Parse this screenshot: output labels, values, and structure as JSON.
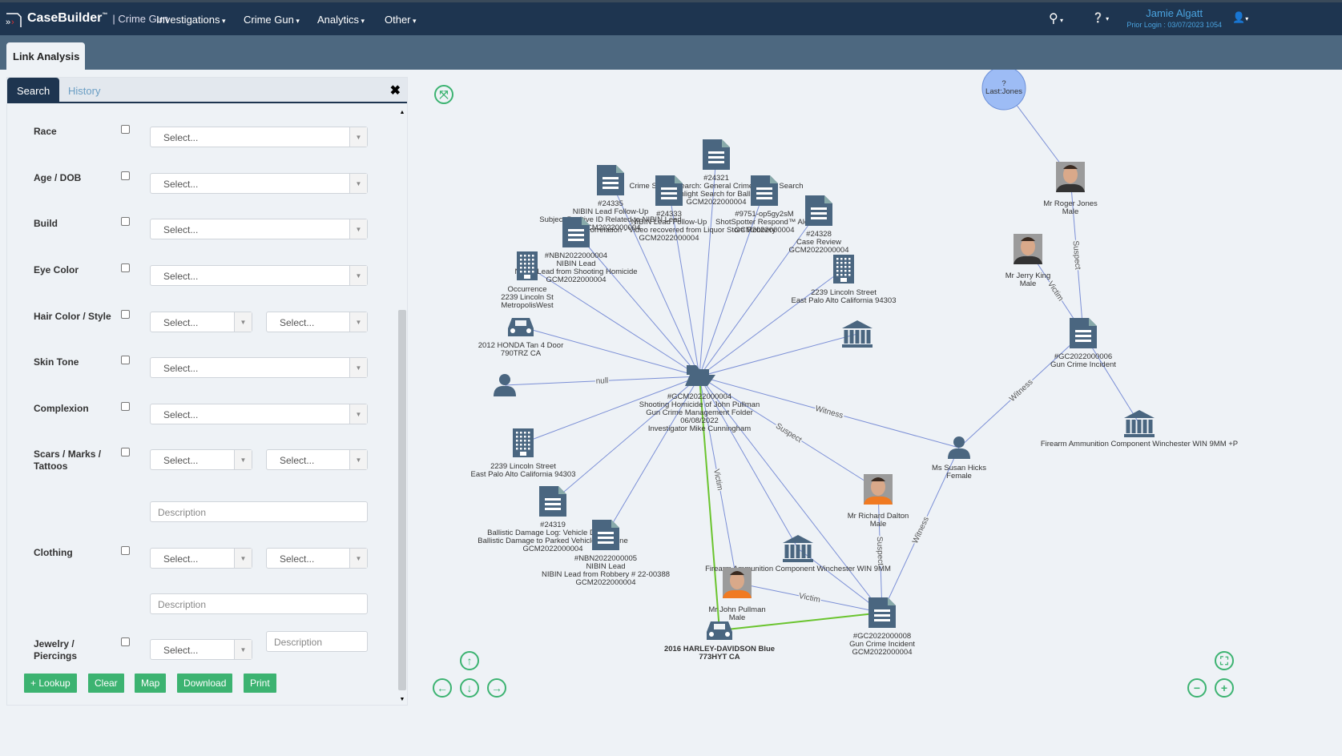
{
  "header": {
    "brand": "CaseBuilder",
    "tm": "™",
    "product": "| Crime Gun",
    "nav": [
      "Investigations",
      "Crime Gun",
      "Analytics",
      "Other"
    ],
    "user_name": "Jamie Algatt",
    "prior_login": "Prior Login : 03/07/2023 1054"
  },
  "main_tab": "Link Analysis",
  "panel": {
    "tabs": [
      "Search",
      "History"
    ],
    "fields": {
      "race": "Race",
      "age": "Age / DOB",
      "build": "Build",
      "eye": "Eye Color",
      "hair": "Hair Color / Style",
      "skin": "Skin Tone",
      "complexion": "Complexion",
      "scars": "Scars / Marks / Tattoos",
      "clothing": "Clothing",
      "jewelry": "Jewelry / Piercings"
    },
    "select_placeholder": "Select...",
    "description_placeholder": "Description",
    "buttons": [
      "+ Lookup",
      "Clear",
      "Map",
      "Download",
      "Print"
    ]
  },
  "graph": {
    "nodes": [
      {
        "id": "center",
        "type": "folder",
        "label": [
          "#GCM2022000004",
          "Shooting Homicide of John Pullman",
          "Gun Crime Management Folder",
          "06/08/2022",
          "Investigator Mike Cunningham"
        ]
      },
      {
        "id": "n24321",
        "type": "doc",
        "label": [
          "#24321",
          "Crime Scene Search: General Crime Scene Search",
          "Flashlight Search for Ballistics",
          "GCM2022000004"
        ]
      },
      {
        "id": "n24335",
        "type": "doc",
        "label": [
          "#24335",
          "NIBIN Lead Follow-Up",
          "Subject Positive ID Related to NIBIN Lead",
          "GCM2022000004"
        ]
      },
      {
        "id": "n24333",
        "type": "doc",
        "label": [
          "#24333",
          "NIBIN Lead Follow-Up",
          "NIBIN Correlation - Video recovered from Liquor Store Robbery",
          "GCM2022000004"
        ]
      },
      {
        "id": "n9751",
        "type": "doc",
        "label": [
          "#9751-op5gy2sM",
          "ShotSpotter Respond™ Alert",
          "GCM2022000004"
        ]
      },
      {
        "id": "n24328",
        "type": "doc",
        "label": [
          "#24328",
          "Case Review",
          "GCM2022000004"
        ]
      },
      {
        "id": "nbn4",
        "type": "doc",
        "label": [
          "#NBN2022000004",
          "NIBIN Lead",
          "NIBIN Lead from Shooting Homicide",
          "GCM2022000004"
        ]
      },
      {
        "id": "occ",
        "type": "building",
        "label": [
          "Occurrence",
          "2239 Lincoln St",
          "MetropolisWest"
        ]
      },
      {
        "id": "addr1",
        "type": "building",
        "label": [
          "2239 Lincoln Street",
          "East Palo Alto California 94303"
        ]
      },
      {
        "id": "car1",
        "type": "car",
        "label": [
          "2012 HONDA Tan 4 Door",
          "790TRZ CA"
        ]
      },
      {
        "id": "bank1",
        "type": "bank",
        "label": []
      },
      {
        "id": "anon",
        "type": "person",
        "label": []
      },
      {
        "id": "addr2",
        "type": "building",
        "label": [
          "2239 Lincoln Street",
          "East Palo Alto California 94303"
        ]
      },
      {
        "id": "n24319",
        "type": "doc",
        "label": [
          "#24319",
          "Ballistic Damage Log: Vehicle Damage",
          "Ballistic Damage to Parked Vehicle at Scene",
          "GCM2022000004"
        ]
      },
      {
        "id": "nbn5",
        "type": "doc",
        "label": [
          "#NBN2022000005",
          "NIBIN Lead",
          "NIBIN Lead from Robbery # 22-00388",
          "GCM2022000004"
        ]
      },
      {
        "id": "bank2",
        "type": "bank",
        "label": [
          "Firearm Ammunition Component Winchester WIN 9MM"
        ]
      },
      {
        "id": "pullman",
        "type": "photo",
        "photo": "orange",
        "label": [
          "Mr John  Pullman",
          "Male"
        ]
      },
      {
        "id": "car2",
        "type": "car",
        "bold": true,
        "label": [
          "2016 HARLEY-DAVIDSON Blue",
          "773HYT CA"
        ]
      },
      {
        "id": "gc8",
        "type": "doc",
        "label": [
          "#GC2022000008",
          "Gun Crime Incident",
          "GCM2022000004"
        ]
      },
      {
        "id": "dalton",
        "type": "photo",
        "photo": "orange",
        "label": [
          "Mr Richard  Dalton",
          "Male"
        ]
      },
      {
        "id": "hicks",
        "type": "person",
        "label": [
          "Ms Susan  Hicks",
          "Female"
        ]
      },
      {
        "id": "gc6",
        "type": "doc",
        "label": [
          "#GC2022000006",
          "Gun Crime Incident"
        ]
      },
      {
        "id": "bank3",
        "type": "bank",
        "label": [
          "Firearm Ammunition Component Winchester WIN 9MM +P"
        ]
      },
      {
        "id": "jones",
        "type": "circle",
        "label": [
          "?",
          "Last:Jones"
        ]
      },
      {
        "id": "rjones",
        "type": "photo",
        "photo": "grey",
        "label": [
          "Mr Roger  Jones",
          "Male"
        ]
      },
      {
        "id": "king",
        "type": "photo",
        "photo": "grey",
        "label": [
          "Mr Jerry  King",
          "Male"
        ]
      }
    ],
    "edges": [
      {
        "from": "center",
        "to": "n24321"
      },
      {
        "from": "center",
        "to": "n24335"
      },
      {
        "from": "center",
        "to": "n24333"
      },
      {
        "from": "center",
        "to": "n9751"
      },
      {
        "from": "center",
        "to": "n24328"
      },
      {
        "from": "center",
        "to": "nbn4"
      },
      {
        "from": "center",
        "to": "occ"
      },
      {
        "from": "center",
        "to": "addr1"
      },
      {
        "from": "center",
        "to": "car1"
      },
      {
        "from": "center",
        "to": "bank1"
      },
      {
        "from": "center",
        "to": "anon",
        "label": "null"
      },
      {
        "from": "center",
        "to": "addr2"
      },
      {
        "from": "center",
        "to": "n24319"
      },
      {
        "from": "center",
        "to": "nbn5"
      },
      {
        "from": "center",
        "to": "bank2"
      },
      {
        "from": "center",
        "to": "pullman",
        "label": "Victim"
      },
      {
        "from": "center",
        "to": "car2",
        "highlight": true
      },
      {
        "from": "center",
        "to": "gc8"
      },
      {
        "from": "center",
        "to": "dalton",
        "label": "Suspect"
      },
      {
        "from": "center",
        "to": "hicks",
        "label": "Witness"
      },
      {
        "from": "gc8",
        "to": "dalton",
        "label": "Suspect"
      },
      {
        "from": "gc8",
        "to": "hicks",
        "label": "Witness"
      },
      {
        "from": "gc8",
        "to": "pullman",
        "label": "Victim"
      },
      {
        "from": "gc8",
        "to": "car2",
        "highlight": true
      },
      {
        "from": "gc8",
        "to": "bank2"
      },
      {
        "from": "gc6",
        "to": "hicks",
        "label": "Witness"
      },
      {
        "from": "gc6",
        "to": "king",
        "label": "Victim"
      },
      {
        "from": "gc6",
        "to": "rjones",
        "label": "Suspect"
      },
      {
        "from": "gc6",
        "to": "bank3"
      },
      {
        "from": "rjones",
        "to": "jones"
      }
    ],
    "colors": {
      "node": "#4a6680",
      "edge": "#7b8fd6",
      "highlight": "#6ac42e",
      "circle": "#9dbcf5"
    }
  },
  "controls": [
    "fit-icon",
    "pan-up-icon",
    "pan-left-icon",
    "pan-down-icon",
    "pan-right-icon",
    "reset-view-icon",
    "zoom-out-icon",
    "zoom-in-icon"
  ]
}
